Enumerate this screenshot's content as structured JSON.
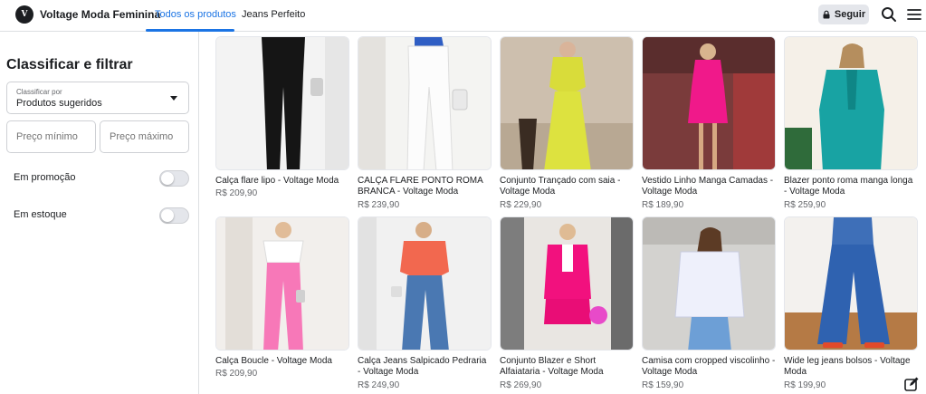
{
  "header": {
    "store_name": "Voltage Moda Feminina",
    "logo_letter": "V",
    "tabs": [
      "Todos os produtos",
      "Jeans Perfeito"
    ],
    "follow_label": "Seguir"
  },
  "sidebar": {
    "title": "Classificar e filtrar",
    "sort_label": "Classificar por",
    "sort_value": "Produtos sugeridos",
    "price_min_placeholder": "Preço mínimo",
    "price_max_placeholder": "Preço máximo",
    "promo_label": "Em promoção",
    "promo_on": false,
    "stock_label": "Em estoque",
    "stock_on": false
  },
  "products": [
    {
      "title": "Calça flare lipo - Voltage Moda",
      "price": "R$ 209,90"
    },
    {
      "title": "CALÇA FLARE PONTO ROMA BRANCA - Voltage Moda",
      "price": "R$ 239,90"
    },
    {
      "title": "Conjunto Trançado com saia - Voltage Moda",
      "price": "R$ 229,90"
    },
    {
      "title": "Vestido Linho Manga Camadas - Voltage Moda",
      "price": "R$ 189,90"
    },
    {
      "title": "Blazer ponto roma manga longa - Voltage Moda",
      "price": "R$ 259,90"
    },
    {
      "title": "Calça Boucle - Voltage Moda",
      "price": "R$ 209,90"
    },
    {
      "title": "Calça Jeans Salpicado Pedraria - Voltage Moda",
      "price": "R$ 249,90"
    },
    {
      "title": "Conjunto Blazer e Short Alfaiataria - Voltage Moda",
      "price": "R$ 269,90"
    },
    {
      "title": "Camisa com cropped viscolinho - Voltage Moda",
      "price": "R$ 159,90"
    },
    {
      "title": "Wide leg jeans bolsos - Voltage Moda",
      "price": "R$ 199,90"
    }
  ],
  "colors": {
    "accent": "#1b74e4",
    "text": "#1c1e21",
    "secondary_text": "#65676b"
  },
  "icons": [
    "lock-icon",
    "search-icon",
    "menu-icon",
    "compose-icon"
  ]
}
